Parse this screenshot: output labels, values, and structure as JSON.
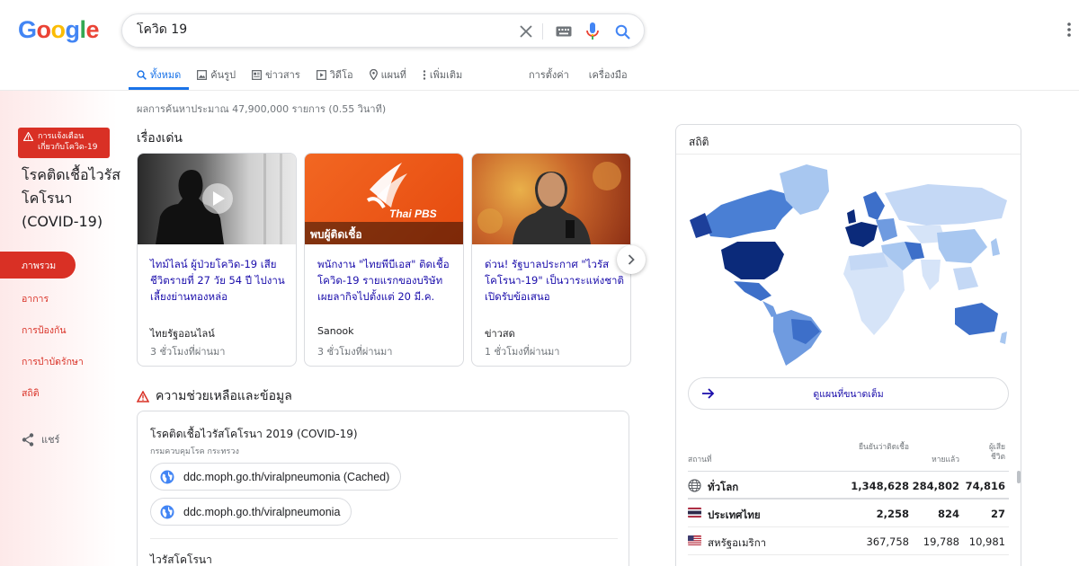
{
  "logo": [
    "G",
    "o",
    "o",
    "g",
    "l",
    "e"
  ],
  "search": {
    "query": "โควิด 19"
  },
  "tabs": [
    {
      "label": "ทั้งหมด"
    },
    {
      "label": "ค้นรูป"
    },
    {
      "label": "ข่าวสาร"
    },
    {
      "label": "วิดีโอ"
    },
    {
      "label": "แผนที่"
    },
    {
      "label": "เพิ่มเติม"
    }
  ],
  "tools": {
    "settings": "การตั้งค่า",
    "tools": "เครื่องมือ"
  },
  "result_stats": "ผลการค้นหาประมาณ 47,900,000 รายการ (0.55 วินาที)",
  "left": {
    "alert": "การแจ้งเตือน\nเกี่ยวกับโควิด-19",
    "title": "โรคติดเชื้อไวรัสโคโรนา (COVID-19)",
    "nav": [
      "ภาพรวม",
      "อาการ",
      "การป้องกัน",
      "การบำบัดรักษา",
      "สถิติ"
    ],
    "share": "แชร์"
  },
  "top_stories": {
    "title": "เรื่องเด่น",
    "cards": [
      {
        "headline": "ไทม์ไลน์ ผู้ป่วยโควิด-19 เสียชีวิตรายที่ 27 วัย 54 ปี ไปงานเลี้ยงย่านทองหล่อ",
        "source": "ไทยรัฐออนไลน์",
        "time": "3 ชั่วโมงที่ผ่านมา"
      },
      {
        "headline": "พนักงาน \"ไทยพีบีเอส\" ติดเชื้อโควิด-19 รายแรกของบริษัท เผยลากิจไปตั้งแต่ 20 มี.ค.",
        "source": "Sanook",
        "time": "3 ชั่วโมงที่ผ่านมา",
        "thumb_logo": "Thai PBS",
        "thumb_caption": "พบผู้ติดเชื้อ"
      },
      {
        "headline": "ด่วน! รัฐบาลประกาศ \"ไวรัสโคโรนา-19\" เป็นวาระแห่งชาติ เปิดรับข้อเสนอ",
        "source": "ข่าวสด",
        "time": "1 ชั่วโมงที่ผ่านมา"
      }
    ]
  },
  "help": {
    "title": "ความช่วยเหลือและข้อมูล",
    "card_title": "โรคติดเชื้อไวรัสโคโรนา 2019 (COVID-19)",
    "card_sub": "กรมควบคุมโรค กระทรวง",
    "links": [
      "ddc.moph.go.th/viralpneumonia (Cached)",
      "ddc.moph.go.th/viralpneumonia"
    ],
    "next_title": "ไวรัสโคโรนา"
  },
  "stats": {
    "title": "สถิติ",
    "map_button": "ดูแผนที่ขนาดเต็ม",
    "headers": {
      "place": "สถานที่",
      "confirmed": "ยืนยันว่าติดเชื้อ",
      "recovered": "หายแล้ว",
      "deaths": "ผู้เสียชีวิต"
    },
    "rows": [
      {
        "name": "ทั่วโลก",
        "confirmed": "1,348,628",
        "recovered": "284,802",
        "deaths": "74,816"
      },
      {
        "name": "ประเทศไทย",
        "confirmed": "2,258",
        "recovered": "824",
        "deaths": "27"
      },
      {
        "name": "สหรัฐอเมริกา",
        "confirmed": "367,758",
        "recovered": "19,788",
        "deaths": "10,981"
      }
    ]
  },
  "colors": {
    "accent": "#1a73e8",
    "alert_red": "#d93025",
    "link": "#1a0dab"
  }
}
